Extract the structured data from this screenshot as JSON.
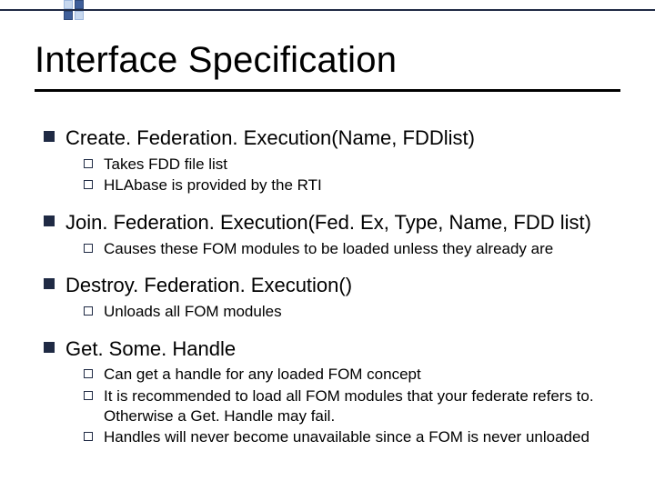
{
  "title": "Interface Specification",
  "items": [
    {
      "label": "Create. Federation. Execution(Name, FDDlist)",
      "sub": [
        "Takes FDD file list",
        "HLAbase is provided by the RTI"
      ]
    },
    {
      "label": "Join. Federation. Execution(Fed. Ex, Type, Name, FDD list)",
      "sub": [
        "Causes these FOM modules to be loaded unless they already are"
      ]
    },
    {
      "label": "Destroy. Federation. Execution()",
      "sub": [
        "Unloads all FOM modules"
      ]
    },
    {
      "label": "Get. Some. Handle",
      "sub": [
        "Can get a handle for any loaded FOM concept",
        "It is recommended to load all FOM modules that your federate refers to. Otherwise a Get. Handle may fail.",
        "Handles will never become unavailable since a FOM is never unloaded"
      ]
    }
  ]
}
